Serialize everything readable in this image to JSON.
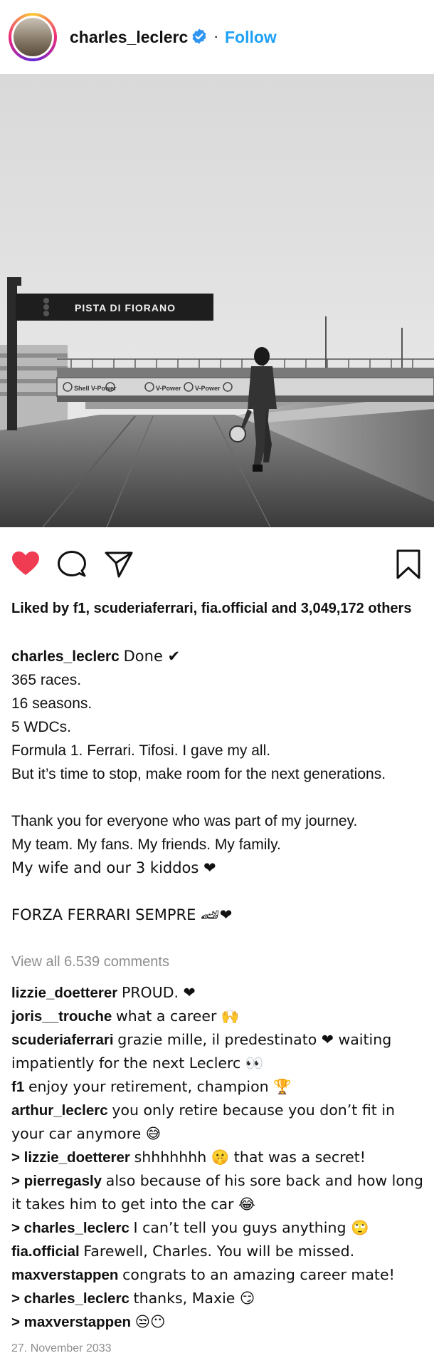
{
  "header": {
    "username": "charles_leclerc",
    "separator": "·",
    "follow_label": "Follow"
  },
  "photo": {
    "sign_text": "PISTA DI FIORANO",
    "banner_text": "Shell V-Power"
  },
  "likes": {
    "text": "Liked by f1, scuderiaferrari, fia.official and 3,049,172 others"
  },
  "caption": {
    "author": "charles_leclerc",
    "lines": [
      "Done ✔",
      "365 races.",
      "16 seasons.",
      "5 WDCs.",
      "Formula 1. Ferrari. Tifosi. I gave my all.",
      "But it’s time to stop, make room for the next generations.",
      "",
      "Thank you for everyone who was part of my journey.",
      "My team. My fans. My friends. My family.",
      "My wife and our 3 kiddos ❤",
      "",
      "FORZA FERRARI SEMPRE 🏎❤"
    ]
  },
  "view_all_label": "View all 6.539 comments",
  "comments": [
    {
      "user": "lizzie_doetterer",
      "text": "PROUD. ❤"
    },
    {
      "user": "joris__trouche",
      "text": "what a career 🙌"
    },
    {
      "user": "scuderiaferrari",
      "text": "grazie mille, il predestinato ❤ waiting impatiently for the next Leclerc 👀"
    },
    {
      "user": "f1",
      "text": "enjoy your retirement, champion 🏆"
    },
    {
      "user": "arthur_leclerc",
      "text": "you only retire because you don’t fit in your car anymore 😅"
    },
    {
      "user": "> lizzie_doetterer",
      "text": "shhhhhhh 🤫 that was a secret!"
    },
    {
      "user": "> pierregasly",
      "text": "also because of his sore back and how long it takes him to get into the car 😂"
    },
    {
      "user": "> charles_leclerc",
      "text": "I can’t tell you guys anything 🙄"
    },
    {
      "user": "fia.official",
      "text": "Farewell, Charles. You will be missed."
    },
    {
      "user": "maxverstappen",
      "text": "congrats to an amazing career mate!"
    },
    {
      "user": "> charles_leclerc",
      "text": "thanks, Maxie 😏"
    },
    {
      "user": "> maxverstappen",
      "text": "😒😶"
    }
  ],
  "date": "27. November 2033",
  "colors": {
    "like_red": "#ef3c52",
    "follow_blue": "#1ea1f7",
    "muted_gray": "#8e8e8e"
  },
  "icons": [
    "heart-icon",
    "comment-icon",
    "share-icon",
    "bookmark-icon",
    "verified-badge-icon"
  ]
}
